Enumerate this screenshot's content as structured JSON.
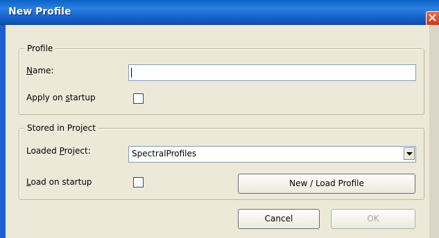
{
  "window": {
    "title": "New Profile"
  },
  "profile_group": {
    "label": "Profile",
    "name_label": "Name:",
    "name_value": "",
    "apply_label": "Apply on startup",
    "apply_checked": false
  },
  "stored_group": {
    "label": "Stored in Project",
    "loaded_project_label": "Loaded Project:",
    "loaded_project_value": "SpectralProfiles",
    "load_on_startup_label": "Load on startup",
    "load_on_startup_checked": false,
    "new_load_button": "New / Load Profile"
  },
  "buttons": {
    "cancel": "Cancel",
    "ok": "OK"
  },
  "icons": {
    "close": "close-icon",
    "dropdown": "chevron-down-icon"
  }
}
